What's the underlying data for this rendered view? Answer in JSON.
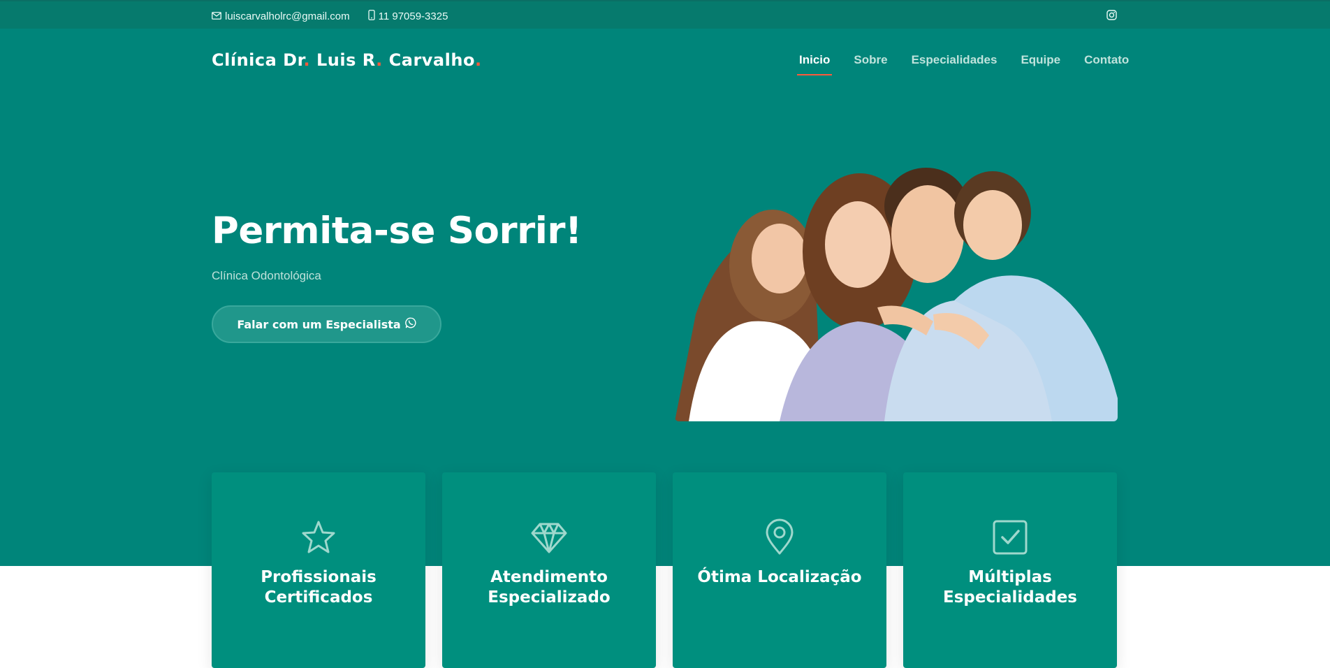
{
  "topbar": {
    "email": "luiscarvalholrc@gmail.com",
    "phone": "11 97059-3325",
    "icons": {
      "email": "envelope-icon",
      "phone": "mobile-phone-icon",
      "social": "instagram-icon"
    }
  },
  "brand": {
    "logo_parts": [
      "Clínica Dr",
      "Luis R",
      "Carvalho"
    ],
    "dot": ".",
    "dot_color": "#ff5a3c"
  },
  "nav": {
    "items": [
      {
        "label": "Inicio",
        "active": true
      },
      {
        "label": "Sobre",
        "active": false
      },
      {
        "label": "Especialidades",
        "active": false
      },
      {
        "label": "Equipe",
        "active": false
      },
      {
        "label": "Contato",
        "active": false
      }
    ]
  },
  "hero": {
    "headline": "Permita-se Sorrir!",
    "subtitle": "Clínica Odontológica",
    "cta_label": "Falar com um Especialista",
    "cta_icon": "whatsapp-icon",
    "image": "smiling-family-photo"
  },
  "features": [
    {
      "icon": "star-icon",
      "title_lines": [
        "Profissionais",
        "Certificados"
      ]
    },
    {
      "icon": "diamond-icon",
      "title_lines": [
        "Atendimento",
        "Especializado"
      ]
    },
    {
      "icon": "map-pin-icon",
      "title_lines": [
        "Ótima Localização"
      ]
    },
    {
      "icon": "checkbox-icon",
      "title_lines": [
        "Múltiplas",
        "Especialidades"
      ]
    }
  ],
  "colors": {
    "primary": "#00857a",
    "topbar": "#067a6d",
    "card": "#008f7e",
    "accent": "#ff5a3c"
  }
}
